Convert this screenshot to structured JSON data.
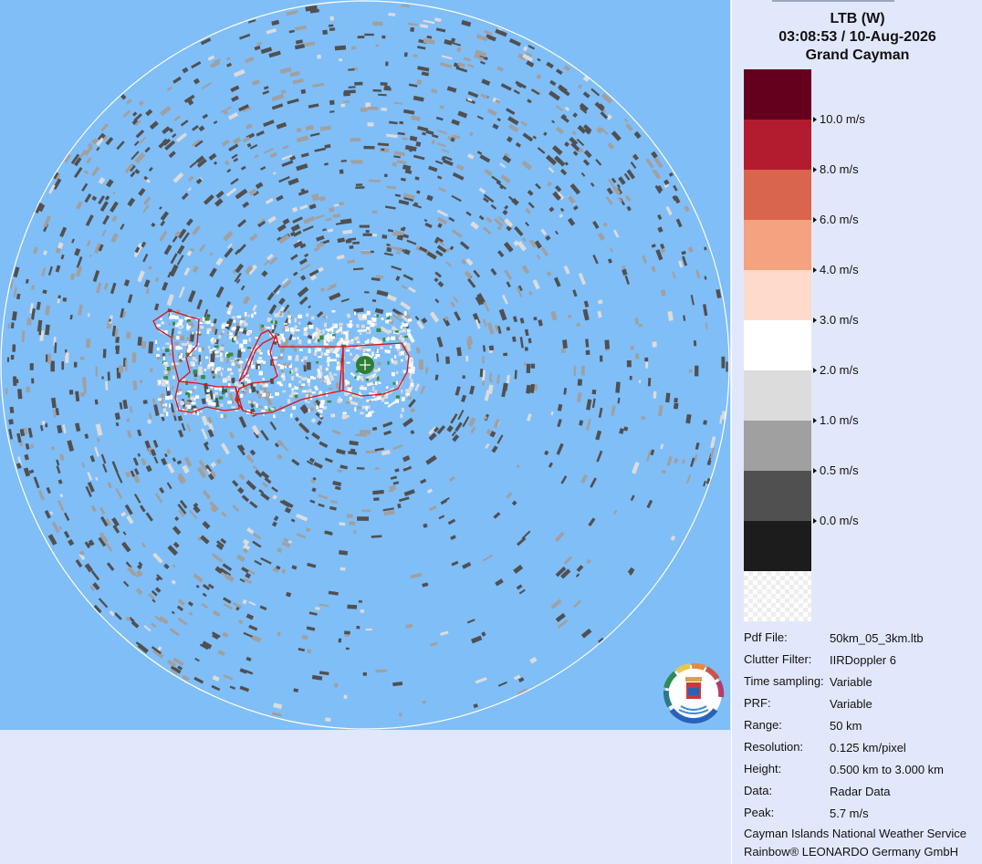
{
  "header": {
    "site": "LTB (W)",
    "datetime": "03:08:53 / 10-Aug-2026",
    "location": "Grand Cayman"
  },
  "legend": {
    "swatches": [
      {
        "color": "#64001e"
      },
      {
        "color": "#b21c2e"
      },
      {
        "color": "#da654d"
      },
      {
        "color": "#f5a27f"
      },
      {
        "color": "#fedacb"
      },
      {
        "color": "#ffffff"
      },
      {
        "color": "#dcdcdc"
      },
      {
        "color": "#a0a0a0"
      },
      {
        "color": "#505050"
      },
      {
        "color": "#1c1c1c"
      },
      {
        "color": "checker"
      }
    ],
    "ticks": [
      "10.0 m/s",
      "8.0 m/s",
      "6.0 m/s",
      "4.0 m/s",
      "3.0 m/s",
      "2.0 m/s",
      "1.0 m/s",
      "0.5 m/s",
      "0.0 m/s"
    ]
  },
  "info": [
    {
      "label": "Pdf File:",
      "value": "50km_05_3km.ltb"
    },
    {
      "label": "Clutter Filter:",
      "value": "IIRDoppler 6"
    },
    {
      "label": "Time sampling:",
      "value": "Variable"
    },
    {
      "label": "PRF:",
      "value": "Variable"
    },
    {
      "label": "Range:",
      "value": "50 km"
    },
    {
      "label": "Resolution:",
      "value": "0.125 km/pixel"
    },
    {
      "label": "Height:",
      "value": "0.500 km to 3.000 km"
    },
    {
      "label": "Data:",
      "value": "Radar Data"
    },
    {
      "label": "Peak:",
      "value": "5.7 m/s"
    }
  ],
  "footer": {
    "line1": "Cayman Islands National Weather Service",
    "line2": "Rainbow® LEONARDO Germany GmbH"
  },
  "colors": {
    "sea": "#80bef8",
    "panel_bg": "#e2e8fb",
    "range_ring": "#ffffff",
    "coastline": "#e01010",
    "radar_site": "#2e7d32",
    "echo_dark": "#505050",
    "echo_mid": "#a0a0a0",
    "echo_light": "#dcdcdc"
  },
  "icons": {
    "radar_site": "radar-site-icon",
    "logo": "cayman-weather-service-logo"
  }
}
